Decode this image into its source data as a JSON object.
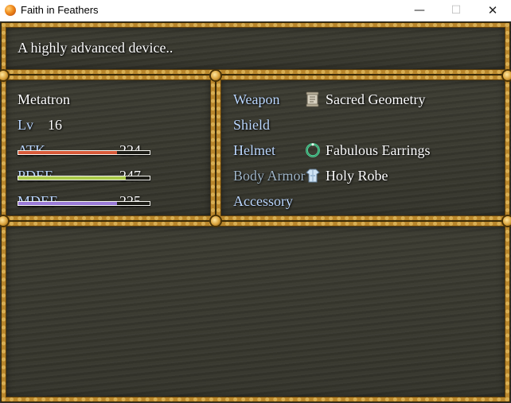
{
  "window": {
    "title": "Faith in Feathers",
    "minimize_glyph": "—",
    "maximize_glyph": "☐",
    "close_glyph": "✕"
  },
  "help": {
    "text": "A highly advanced device.."
  },
  "actor": {
    "name": "Metatron",
    "level_label": "Lv",
    "level": "16",
    "stats": [
      {
        "label": "ATK",
        "value": "224",
        "fill": 0.75,
        "color": "#d85a3a"
      },
      {
        "label": "PDEF",
        "value": "247",
        "fill": 0.82,
        "color": "#a9c94a"
      },
      {
        "label": "MDEF",
        "value": "225",
        "fill": 0.75,
        "color": "#9a7ad8"
      }
    ]
  },
  "equipment": {
    "slots": [
      {
        "label": "Weapon",
        "item": "Sacred Geometry",
        "icon": "scroll-icon"
      },
      {
        "label": "Shield",
        "item": "",
        "icon": ""
      },
      {
        "label": "Helmet",
        "item": "Fabulous Earrings",
        "icon": "ring-icon"
      },
      {
        "label": "Body Armor",
        "item": "Holy Robe",
        "icon": "robe-icon"
      },
      {
        "label": "Accessory",
        "item": "",
        "icon": ""
      }
    ]
  },
  "colors": {
    "system_text": "#bcd8ff",
    "frame_gold": "#b8862c",
    "window_fill": "#38382f"
  }
}
